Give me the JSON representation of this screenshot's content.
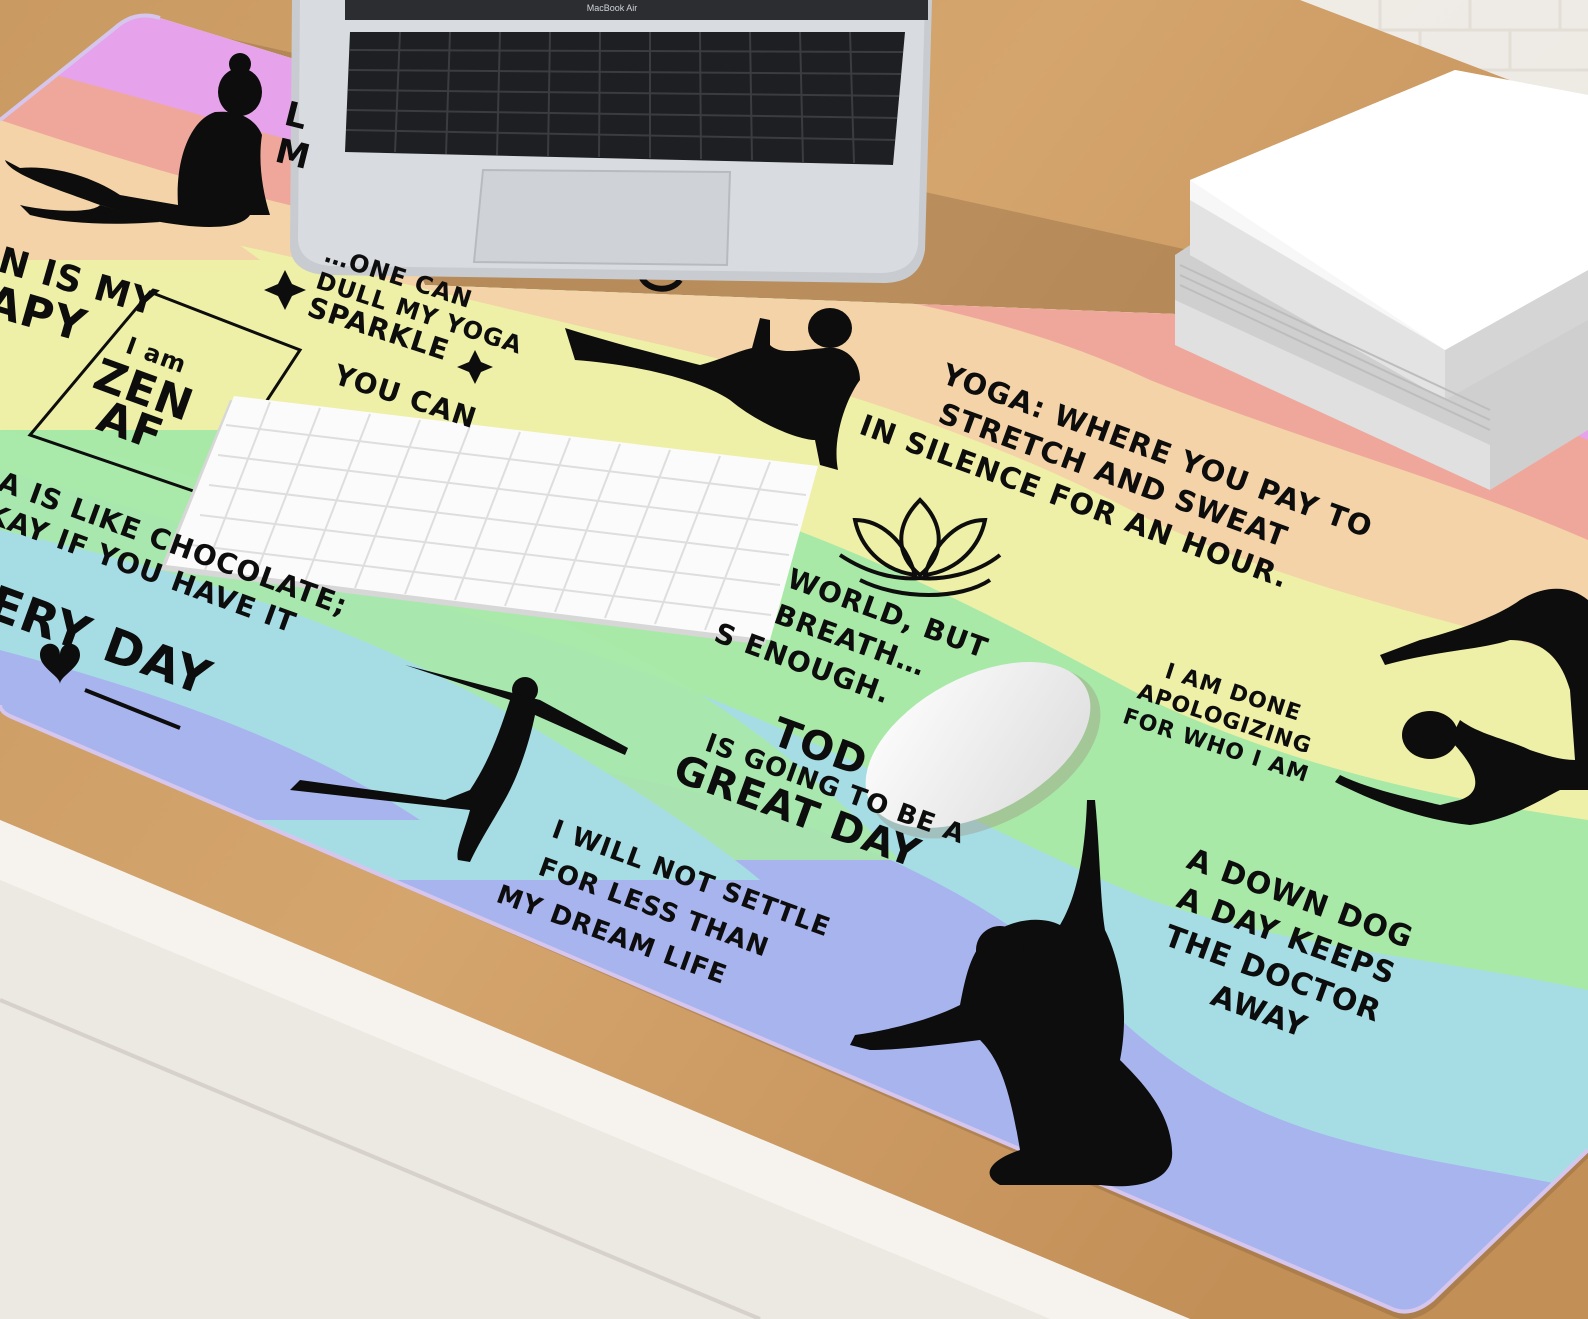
{
  "laptop": {
    "brand_label": "MacBook Air"
  },
  "mousepad": {
    "palette": [
      "#e6a2ea",
      "#f0a79b",
      "#f3d3a7",
      "#eef0a8",
      "#a8e9a8",
      "#a6dde4",
      "#a8b4ee"
    ],
    "quotes": {
      "left_top_partial": [
        "L",
        "M"
      ],
      "yoga_therapy": [
        "n is my",
        "apy"
      ],
      "sparkle": [
        "…one can",
        "dull my yoga",
        "sparkle"
      ],
      "zen": [
        "I am",
        "ZEN",
        "AF"
      ],
      "you_can": "You can",
      "chocolate": [
        "a is like chocolate;",
        "kay if you have it"
      ],
      "every_day": "ERY DAY",
      "stretch": [
        "Yoga: where you pay to",
        "stretch and sweat",
        "in silence for an hour."
      ],
      "world": [
        "world, but",
        "breath…",
        "s enough."
      ],
      "apologizing": [
        "I am done",
        "apologizing",
        "for who I am"
      ],
      "today": [
        "tod",
        "is going to be a",
        "great day"
      ],
      "settle": [
        "I will not settle",
        "for less than",
        "my dream life"
      ],
      "down_dog": [
        "A down dog",
        "a day keeps",
        "the doctor",
        "away"
      ]
    }
  },
  "icons": [
    "yoga-meditation-silhouette",
    "yoga-seated-twist-silhouette",
    "yoga-warrior-silhouette",
    "yoga-scorpion-silhouette",
    "yoga-reaching-silhouette",
    "lotus-icon",
    "sparkle-star-icon",
    "heart-icon"
  ]
}
